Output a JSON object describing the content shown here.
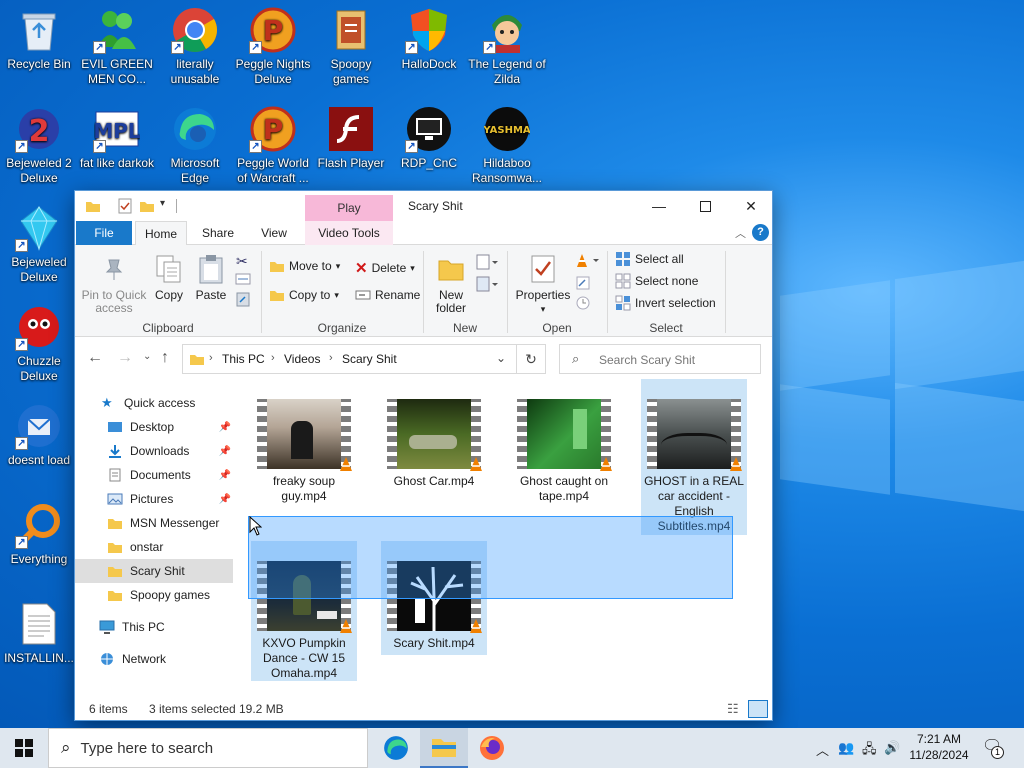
{
  "desktop": {
    "icons": [
      {
        "label": "Recycle Bin",
        "icon": "recycle-bin-icon"
      },
      {
        "label": "EVIL GREEN MEN CO...",
        "icon": "msn-messenger-icon"
      },
      {
        "label": "literally unusable",
        "icon": "chrome-icon"
      },
      {
        "label": "Peggle Nights Deluxe",
        "icon": "peggle-icon"
      },
      {
        "label": "Spoopy games",
        "icon": "folder-icon"
      },
      {
        "label": "HalloDock",
        "icon": "shield-icon"
      },
      {
        "label": "The Legend of Zilda",
        "icon": "zilda-game-icon"
      },
      {
        "label": "Bejeweled 2 Deluxe",
        "icon": "bejeweled2-icon"
      },
      {
        "label": "fat like darkok",
        "icon": "mpl-icon"
      },
      {
        "label": "Microsoft Edge",
        "icon": "edge-icon"
      },
      {
        "label": "Peggle World of Warcraft ...",
        "icon": "peggle-icon"
      },
      {
        "label": "Flash Player",
        "icon": "flash-icon"
      },
      {
        "label": "RDP_CnC",
        "icon": "rdp-icon"
      },
      {
        "label": "Hildaboo Ransomwa...",
        "icon": "yashma-icon"
      },
      {
        "label": "Bejeweled Deluxe",
        "icon": "bejeweled-icon"
      },
      {
        "label": "Chuzzle Deluxe",
        "icon": "chuzzle-icon"
      },
      {
        "label": "doesnt load",
        "icon": "thunderbird-icon"
      },
      {
        "label": "Everything",
        "icon": "everything-search-icon"
      },
      {
        "label": "INSTALLIN...",
        "icon": "text-file-icon"
      }
    ]
  },
  "explorer": {
    "title": "Scary Shit",
    "contextual_tab": "Play",
    "tabs": {
      "file": "File",
      "home": "Home",
      "share": "Share",
      "view": "View",
      "video_tools": "Video Tools"
    },
    "ribbon": {
      "clipboard": {
        "pin": "Pin to Quick access",
        "copy": "Copy",
        "paste": "Paste",
        "label": "Clipboard"
      },
      "organize": {
        "move_to": "Move to",
        "copy_to": "Copy to",
        "delete": "Delete",
        "rename": "Rename",
        "label": "Organize"
      },
      "new": {
        "new_folder": "New folder",
        "label": "New"
      },
      "open": {
        "properties": "Properties",
        "label": "Open"
      },
      "select": {
        "select_all": "Select all",
        "select_none": "Select none",
        "invert": "Invert selection",
        "label": "Select"
      }
    },
    "address": {
      "crumbs": [
        "This PC",
        "Videos",
        "Scary Shit"
      ],
      "search_placeholder": "Search Scary Shit"
    },
    "nav": {
      "quick_access": "Quick access",
      "items": [
        {
          "label": "Desktop",
          "pinned": true
        },
        {
          "label": "Downloads",
          "pinned": true
        },
        {
          "label": "Documents",
          "pinned": true
        },
        {
          "label": "Pictures",
          "pinned": true
        },
        {
          "label": "MSN Messenger",
          "pinned": false
        },
        {
          "label": "onstar",
          "pinned": false
        },
        {
          "label": "Scary Shit",
          "pinned": false
        },
        {
          "label": "Spoopy games",
          "pinned": false
        }
      ],
      "this_pc": "This PC",
      "network": "Network"
    },
    "files": [
      {
        "name": "freaky soup guy.mp4",
        "selected": false
      },
      {
        "name": "Ghost Car.mp4",
        "selected": false
      },
      {
        "name": "Ghost caught on tape.mp4",
        "selected": false
      },
      {
        "name": "GHOST in a REAL car accident - English Subtitles.mp4",
        "selected": true
      },
      {
        "name": "KXVO Pumpkin Dance - CW 15 Omaha.mp4",
        "selected": true
      },
      {
        "name": "Scary Shit.mp4",
        "selected": true
      }
    ],
    "status": {
      "items": "6 items",
      "selected": "3 items selected",
      "size": "19.2 MB"
    }
  },
  "taskbar": {
    "search_placeholder": "Type here to search",
    "time": "7:21 AM",
    "date": "11/28/2024",
    "notification_count": "1"
  },
  "colors": {
    "accent": "#1979ca",
    "selection": "#cce4f7",
    "play_tab": "#f7b8d8"
  }
}
